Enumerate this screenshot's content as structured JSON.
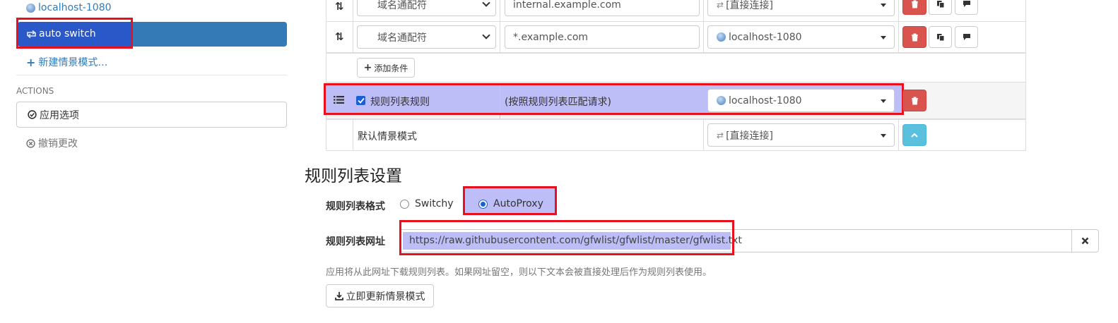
{
  "sidebar": {
    "profiles": [
      {
        "label": "localhost-1080",
        "icon": "globe-icon"
      },
      {
        "label": "auto switch",
        "icon": "switch-icon",
        "active": true
      }
    ],
    "new_profile": "新建情景模式…",
    "actions_header": "ACTIONS",
    "apply_options": "应用选项",
    "discard_changes": "撤销更改"
  },
  "rules": {
    "rows": [
      {
        "condition_type": "域名通配符",
        "pattern": "internal.example.com",
        "profile": "[直接连接]"
      },
      {
        "condition_type": "域名通配符",
        "pattern": "*.example.com",
        "profile": "localhost-1080"
      }
    ],
    "add_condition": "添加条件",
    "rule_list_row": {
      "label": "规则列表规则",
      "checked": true,
      "description": "(按照规则列表匹配请求)",
      "profile": "localhost-1080"
    },
    "default_row": {
      "label": "默认情景模式",
      "profile": "[直接连接]"
    }
  },
  "rule_list_settings": {
    "title": "规则列表设置",
    "format_label": "规则列表格式",
    "format_options": [
      "Switchy",
      "AutoProxy"
    ],
    "format_selected": "AutoProxy",
    "url_label": "规则列表网址",
    "url_value": "https://raw.githubusercontent.com/gfwlist/gfwlist/master/gfwlist.txt",
    "help_text": "应用将从此网址下载规则列表。如果网址留空，则以下文本会被直接处理后作为规则列表使用。",
    "update_button": "立即更新情景模式"
  },
  "colors": {
    "accent": "#337ab7",
    "danger": "#d9534f",
    "info": "#5bc0de",
    "highlight_border": "#e8101c",
    "highlight_fill": "#bdbdf7"
  }
}
